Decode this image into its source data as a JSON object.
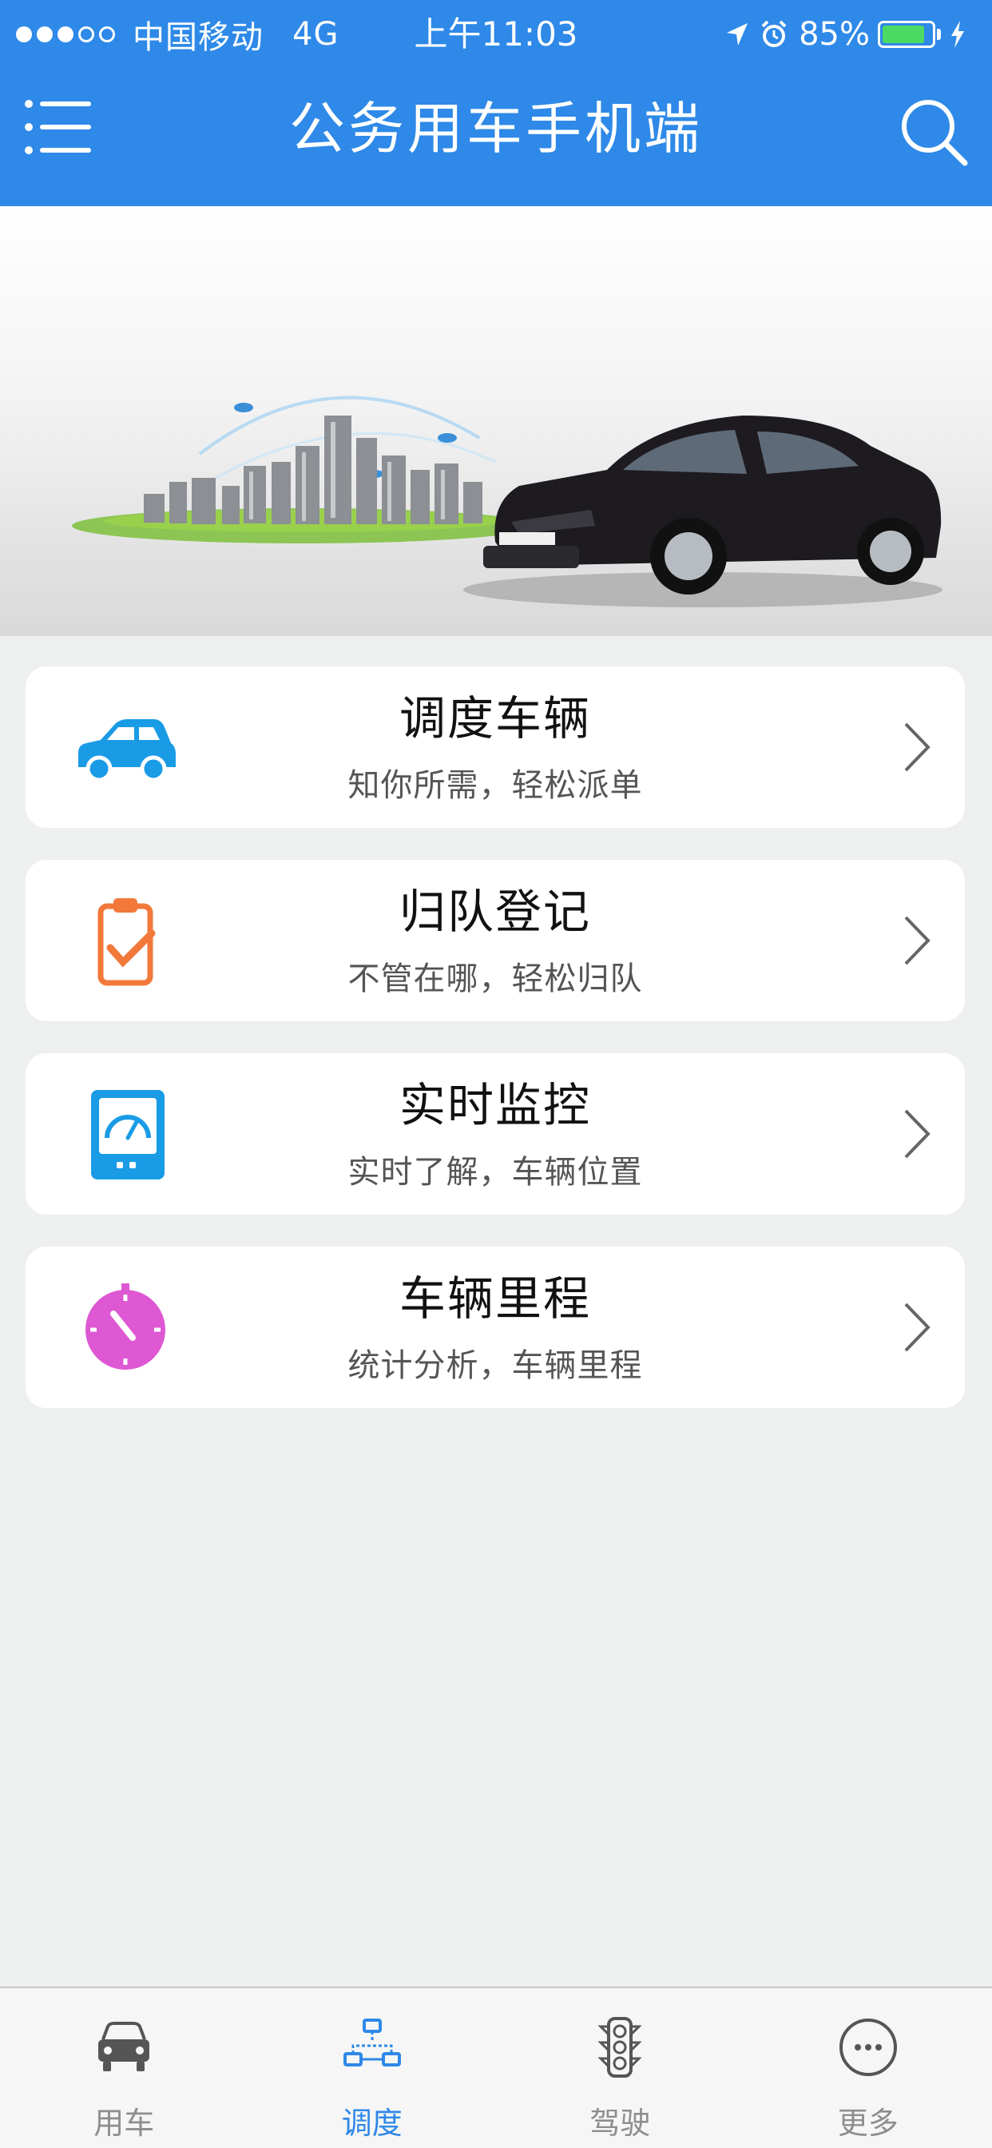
{
  "status_bar": {
    "signal_full": 3,
    "signal_total": 5,
    "carrier": "中国移动",
    "network": "4G",
    "time": "上午11:03",
    "battery": "85%",
    "battery_level": 0.85
  },
  "header": {
    "title": "公务用车手机端",
    "menu_icon": "menu-icon",
    "search_icon": "search-icon"
  },
  "colors": {
    "primary": "#2e89e8",
    "car_icon": "#1a9be6",
    "register_icon": "#f2793a",
    "monitor_icon": "#1a9be6",
    "mileage_icon": "#de57d3"
  },
  "menu": [
    {
      "title": "调度车辆",
      "subtitle": "知你所需，轻松派单",
      "icon": "car-icon"
    },
    {
      "title": "归队登记",
      "subtitle": "不管在哪，轻松归队",
      "icon": "clipboard-check-icon"
    },
    {
      "title": "实时监控",
      "subtitle": "实时了解，车辆位置",
      "icon": "monitor-gauge-icon"
    },
    {
      "title": "车辆里程",
      "subtitle": "统计分析，车辆里程",
      "icon": "stopwatch-icon"
    }
  ],
  "tabs": [
    {
      "label": "用车",
      "icon": "car-front-icon",
      "active": false
    },
    {
      "label": "调度",
      "icon": "dispatch-network-icon",
      "active": true
    },
    {
      "label": "驾驶",
      "icon": "traffic-light-icon",
      "active": false
    },
    {
      "label": "更多",
      "icon": "more-icon",
      "active": false
    }
  ]
}
